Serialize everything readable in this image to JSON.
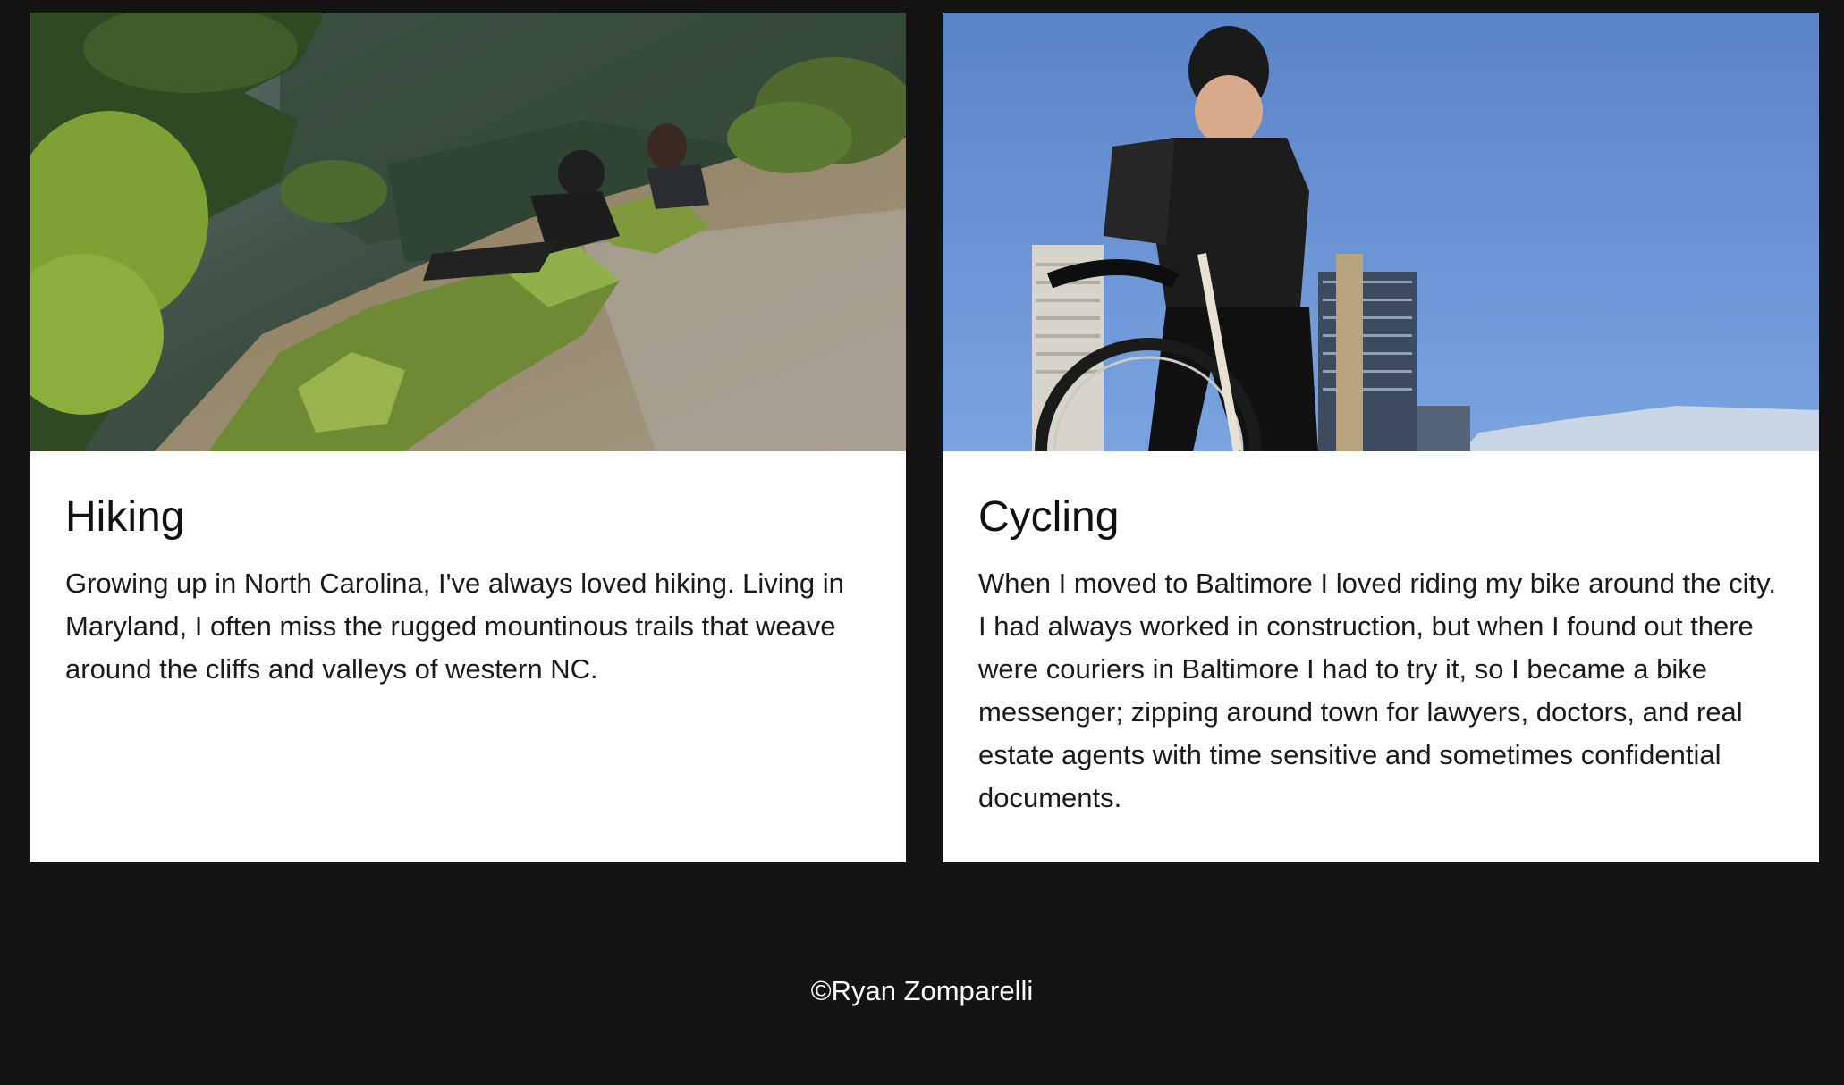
{
  "cards": [
    {
      "title": "Hiking",
      "image": "hikers-resting-on-mountain-ledge",
      "text": "Growing up in North Carolina, I've always loved hiking. Living in Maryland, I often miss the rugged mountinous trails that weave around the cliffs and valleys of western NC."
    },
    {
      "title": "Cycling",
      "image": "cyclist-with-city-skyline",
      "text": "When I moved to Baltimore I loved riding my bike around the city. I had always worked in construction, but when I found out there were couriers in Baltimore I had to try it, so I became a bike messenger; zipping around town for lawyers, doctors, and real estate agents with time sensitive and sometimes confidential documents."
    }
  ],
  "footer": {
    "copyright": "©Ryan Zomparelli"
  },
  "colors": {
    "background": "#141414",
    "card": "#ffffff",
    "sky": "#5d86c9"
  }
}
